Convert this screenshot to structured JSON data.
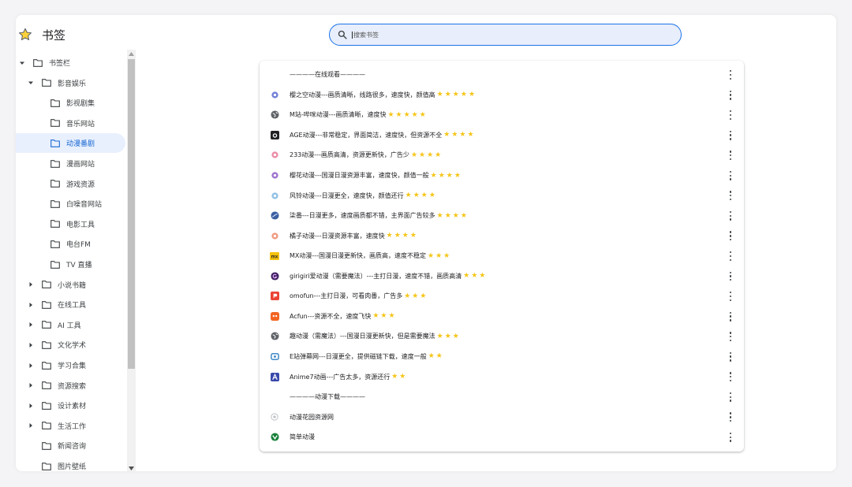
{
  "app": {
    "title": "书签",
    "search_placeholder": "搜索书签",
    "accent_color": "#1a73e8",
    "star_color": "#f5c518"
  },
  "sidebar": {
    "items": [
      {
        "label": "书签栏",
        "level": 0,
        "arrow": "down"
      },
      {
        "label": "影音娱乐",
        "level": 1,
        "arrow": "down"
      },
      {
        "label": "影视剧集",
        "level": 2,
        "arrow": "none"
      },
      {
        "label": "音乐网站",
        "level": 2,
        "arrow": "none"
      },
      {
        "label": "动漫番剧",
        "level": 2,
        "arrow": "none",
        "selected": true
      },
      {
        "label": "漫画网站",
        "level": 2,
        "arrow": "none"
      },
      {
        "label": "游戏资源",
        "level": 2,
        "arrow": "none"
      },
      {
        "label": "白噪音网站",
        "level": 2,
        "arrow": "none"
      },
      {
        "label": "电影工具",
        "level": 2,
        "arrow": "none"
      },
      {
        "label": "电台FM",
        "level": 2,
        "arrow": "none"
      },
      {
        "label": "TV 直播",
        "level": 2,
        "arrow": "none"
      },
      {
        "label": "小说书籍",
        "level": 1,
        "arrow": "right"
      },
      {
        "label": "在线工具",
        "level": 1,
        "arrow": "right"
      },
      {
        "label": "AI 工具",
        "level": 1,
        "arrow": "right"
      },
      {
        "label": "文化学术",
        "level": 1,
        "arrow": "right"
      },
      {
        "label": "学习合集",
        "level": 1,
        "arrow": "right"
      },
      {
        "label": "资源搜索",
        "level": 1,
        "arrow": "right"
      },
      {
        "label": "设计素材",
        "level": 1,
        "arrow": "right"
      },
      {
        "label": "生活工作",
        "level": 1,
        "arrow": "right"
      },
      {
        "label": "新闻咨询",
        "level": 1,
        "arrow": "none"
      },
      {
        "label": "图片壁纸",
        "level": 1,
        "arrow": "none"
      }
    ]
  },
  "bookmarks": [
    {
      "title": "————在线观看————",
      "stars": 0,
      "icon": "none"
    },
    {
      "title": "樱之空动漫---画质清晰，线路很多，速度快，颜值高",
      "stars": 5,
      "icon": "sakura-icon",
      "color": "#5b6bd1"
    },
    {
      "title": "M站-哔咪动漫---画质清晰，速度快",
      "stars": 5,
      "icon": "globe-icon",
      "color": "#5f6368"
    },
    {
      "title": "AGE动漫---非常稳定，界面简洁，速度快，但资源不全",
      "stars": 4,
      "icon": "age-icon",
      "color": "#202124"
    },
    {
      "title": "233动漫---画质高清，资源更新快，广告少",
      "stars": 4,
      "icon": "anime-233-icon",
      "color": "#e97a9a"
    },
    {
      "title": "樱花动漫---国漫日漫资源丰富，速度快，颜值一般",
      "stars": 4,
      "icon": "sakura-anime-icon",
      "color": "#8e5cc7"
    },
    {
      "title": "风铃动漫---日漫更全，速度快，颜值还行",
      "stars": 4,
      "icon": "windbell-icon",
      "color": "#7fb7e0"
    },
    {
      "title": "柒番---日漫更多，速度画质都不错，主界面广告较多",
      "stars": 4,
      "icon": "qifan-icon",
      "color": "#3b5fa0"
    },
    {
      "title": "橘子动漫---日漫资源丰富，速度快",
      "stars": 4,
      "icon": "orange-icon",
      "color": "#ef8b6b"
    },
    {
      "title": "MX动漫---国漫日漫更新快，画质高，速度不稳定",
      "stars": 3,
      "icon": "mx-icon",
      "color": "#f4c20d"
    },
    {
      "title": "girigiri爱动漫（需要魔法）---主打日漫，速度不错，画质高清",
      "stars": 3,
      "icon": "girigiri-icon",
      "color": "#7b3fb8"
    },
    {
      "title": "omofun---主打日漫，可看肉番，广告多",
      "stars": 3,
      "icon": "omofun-icon",
      "color": "#ea4335"
    },
    {
      "title": "Acfun---资源不全，速度飞快",
      "stars": 3,
      "icon": "acfun-icon",
      "color": "#f26522"
    },
    {
      "title": "趣动漫（需魔法）---国漫日漫更新快，但是需要魔法",
      "stars": 3,
      "icon": "globe-icon",
      "color": "#5f6368"
    },
    {
      "title": "E站弹幕网---日漫更全，提供磁链下载，速度一般",
      "stars": 2,
      "icon": "danmaku-icon",
      "color": "#2f7fc1"
    },
    {
      "title": "Anime7动画---广告太多，资源还行",
      "stars": 2,
      "icon": "anime7-icon",
      "color": "#3949ab"
    },
    {
      "title": "————动漫下载————",
      "stars": 0,
      "icon": "none"
    },
    {
      "title": "动漫花园资源网",
      "stars": 0,
      "icon": "dmhy-icon",
      "color": "#9aa0a6"
    },
    {
      "title": "简单动漫",
      "stars": 0,
      "icon": "jiandan-icon",
      "color": "#188038"
    }
  ]
}
